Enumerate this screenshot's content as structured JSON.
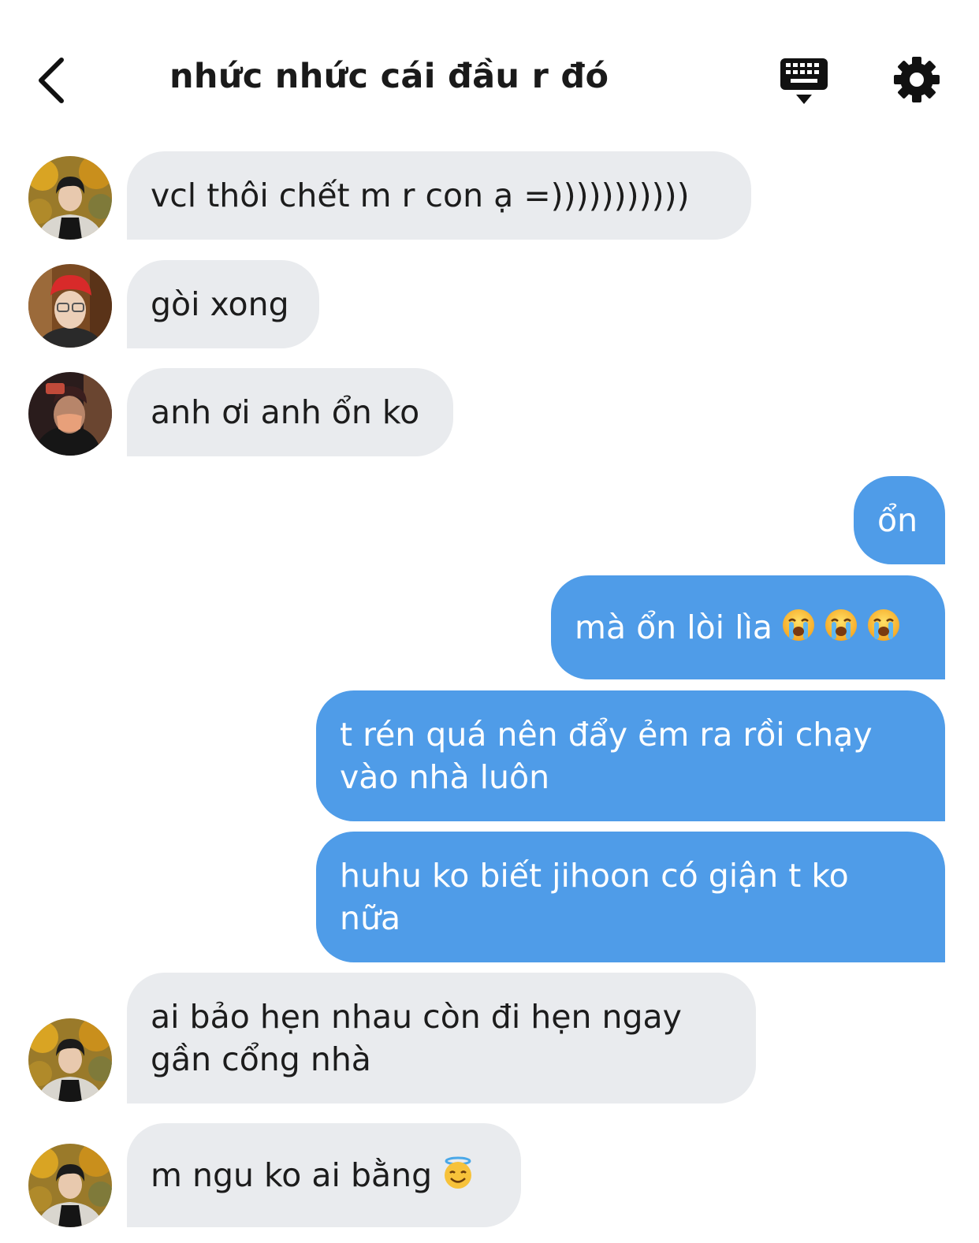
{
  "header": {
    "title": "nhức nhức cái đầu r đó",
    "back_icon": "chevron-left-icon",
    "keyboard_icon": "keyboard-hide-icon",
    "settings_icon": "gear-icon"
  },
  "colors": {
    "incoming_bubble": "#e9ebee",
    "outgoing_bubble": "#4f9ce8",
    "text_dark": "#1c1c1c",
    "text_light": "#ffffff"
  },
  "messages": [
    {
      "direction": "in",
      "avatar": "avatar-a",
      "text": "vcl thôi chết m r con ạ =)))))))))))"
    },
    {
      "direction": "in",
      "avatar": "avatar-b",
      "text": "gòi xong"
    },
    {
      "direction": "in",
      "avatar": "avatar-c",
      "text": "anh ơi anh ổn ko"
    },
    {
      "direction": "out",
      "text": "ổn"
    },
    {
      "direction": "out",
      "text": "mà ổn lòi lìa",
      "emojis": [
        "loudly-crying-face",
        "loudly-crying-face",
        "loudly-crying-face"
      ]
    },
    {
      "direction": "out",
      "lines": [
        "t rén quá nên đẩy ẻm ra rồi chạy",
        "vào nhà luôn"
      ]
    },
    {
      "direction": "out",
      "lines": [
        "huhu ko biết jihoon có giận t ko",
        "nữa"
      ]
    },
    {
      "direction": "in",
      "avatar": "avatar-a",
      "lines": [
        "ai bảo hẹn nhau còn đi hẹn ngay",
        "gần cổng nhà"
      ]
    },
    {
      "direction": "in",
      "avatar": "avatar-a",
      "text": "m ngu ko ai bằng",
      "emojis": [
        "smiling-face-with-halo"
      ]
    }
  ]
}
